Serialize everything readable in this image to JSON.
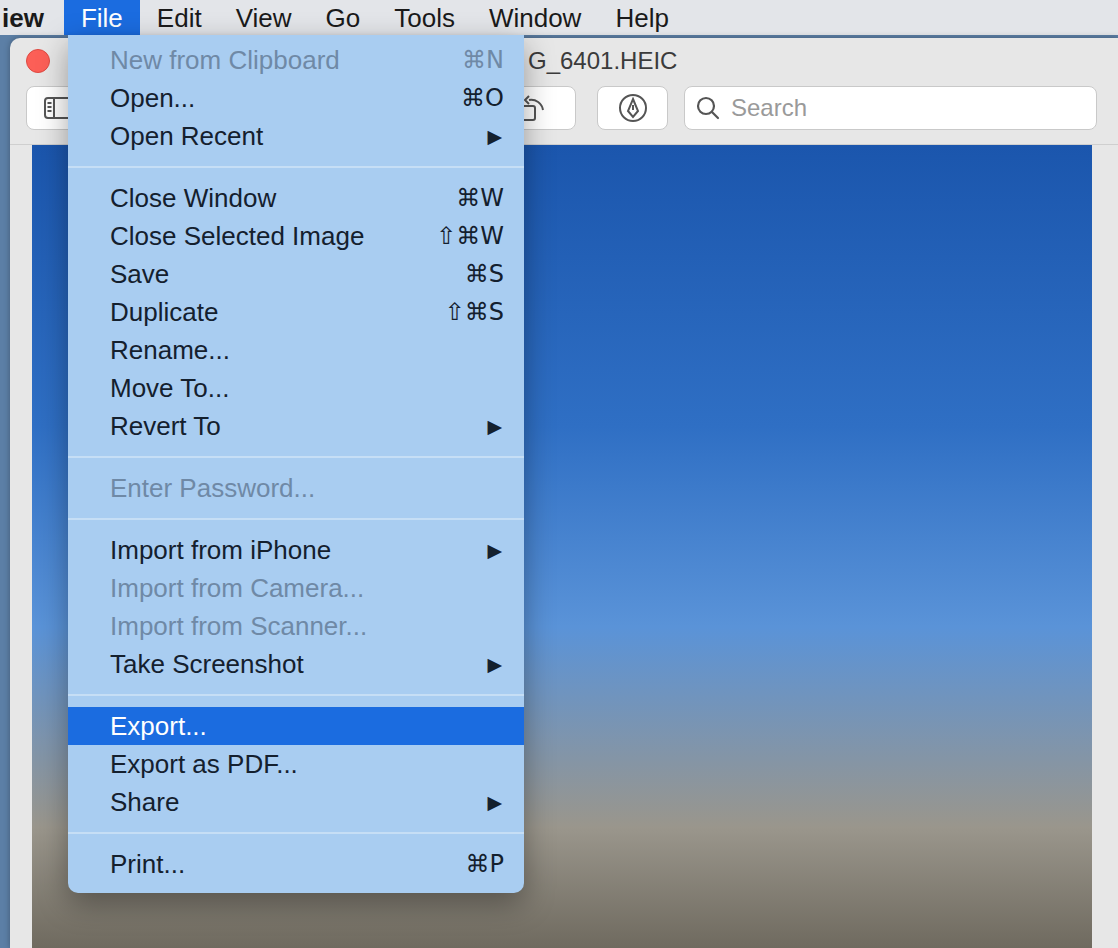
{
  "menubar": {
    "items": [
      {
        "label": "iew",
        "kind": "app",
        "selected": false
      },
      {
        "label": "File",
        "kind": "menu",
        "selected": true
      },
      {
        "label": "Edit",
        "kind": "menu",
        "selected": false
      },
      {
        "label": "View",
        "kind": "menu",
        "selected": false
      },
      {
        "label": "Go",
        "kind": "menu",
        "selected": false
      },
      {
        "label": "Tools",
        "kind": "menu",
        "selected": false
      },
      {
        "label": "Window",
        "kind": "menu",
        "selected": false
      },
      {
        "label": "Help",
        "kind": "menu",
        "selected": false
      }
    ]
  },
  "window": {
    "title": "G_6401.HEIC"
  },
  "toolbar": {
    "search": {
      "placeholder": "Search"
    }
  },
  "menu": {
    "items": [
      {
        "kind": "item",
        "label": "New from Clipboard",
        "trailing": "⌘N",
        "disabled": true,
        "selected": false
      },
      {
        "kind": "item",
        "label": "Open...",
        "trailing": "⌘O",
        "disabled": false,
        "selected": false
      },
      {
        "kind": "submenu",
        "label": "Open Recent",
        "trailing": "▶",
        "disabled": false,
        "selected": false
      },
      {
        "kind": "separator"
      },
      {
        "kind": "item",
        "label": "Close Window",
        "trailing": "⌘W",
        "disabled": false,
        "selected": false
      },
      {
        "kind": "item",
        "label": "Close Selected Image",
        "trailing": "⇧⌘W",
        "disabled": false,
        "selected": false
      },
      {
        "kind": "item",
        "label": "Save",
        "trailing": "⌘S",
        "disabled": false,
        "selected": false
      },
      {
        "kind": "item",
        "label": "Duplicate",
        "trailing": "⇧⌘S",
        "disabled": false,
        "selected": false
      },
      {
        "kind": "item",
        "label": "Rename...",
        "trailing": "",
        "disabled": false,
        "selected": false
      },
      {
        "kind": "item",
        "label": "Move To...",
        "trailing": "",
        "disabled": false,
        "selected": false
      },
      {
        "kind": "submenu",
        "label": "Revert To",
        "trailing": "▶",
        "disabled": false,
        "selected": false
      },
      {
        "kind": "separator"
      },
      {
        "kind": "item",
        "label": "Enter Password...",
        "trailing": "",
        "disabled": true,
        "selected": false
      },
      {
        "kind": "separator"
      },
      {
        "kind": "submenu",
        "label": "Import from iPhone",
        "trailing": "▶",
        "disabled": false,
        "selected": false
      },
      {
        "kind": "item",
        "label": "Import from Camera...",
        "trailing": "",
        "disabled": true,
        "selected": false
      },
      {
        "kind": "item",
        "label": "Import from Scanner...",
        "trailing": "",
        "disabled": true,
        "selected": false
      },
      {
        "kind": "submenu",
        "label": "Take Screenshot",
        "trailing": "▶",
        "disabled": false,
        "selected": false
      },
      {
        "kind": "separator"
      },
      {
        "kind": "item",
        "label": "Export...",
        "trailing": "",
        "disabled": false,
        "selected": true
      },
      {
        "kind": "item",
        "label": "Export as PDF...",
        "trailing": "",
        "disabled": false,
        "selected": false
      },
      {
        "kind": "submenu",
        "label": "Share",
        "trailing": "▶",
        "disabled": false,
        "selected": false
      },
      {
        "kind": "separator"
      },
      {
        "kind": "item",
        "label": "Print...",
        "trailing": "⌘P",
        "disabled": false,
        "selected": false
      }
    ]
  }
}
